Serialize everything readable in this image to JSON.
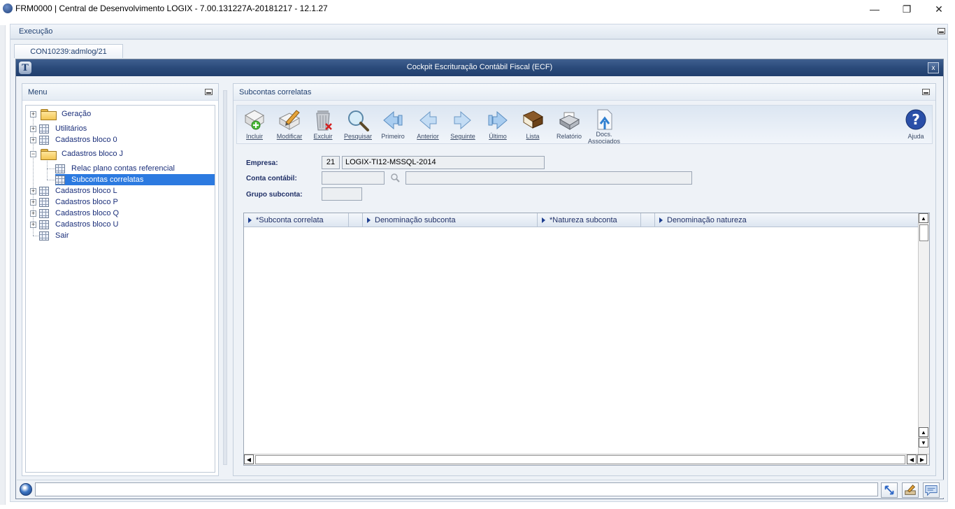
{
  "os_window": {
    "title": "FRM0000 | Central de Desenvolvimento LOGIX  -  7.00.131227A-20181217  -  12.1.27",
    "minimize_glyph": "—",
    "restore_glyph": "❐",
    "close_glyph": "✕"
  },
  "execution_bar": {
    "label": "Execução"
  },
  "tab": {
    "label": "CON10239:admlog/21"
  },
  "window": {
    "title": "Cockpit Escrituração Contábil Fiscal (ECF)",
    "logo": "T",
    "close_glyph": "x"
  },
  "menu": {
    "title": "Menu",
    "items": [
      {
        "label": "Geração",
        "type": "folder",
        "expander": "+"
      },
      {
        "label": "Utilitários",
        "type": "grid",
        "expander": "+"
      },
      {
        "label": "Cadastros bloco 0",
        "type": "grid",
        "expander": "+"
      },
      {
        "label": "Cadastros bloco J",
        "type": "folder",
        "expander": "−"
      },
      {
        "label": "Relac plano contas referencial",
        "type": "grid",
        "child": true
      },
      {
        "label": "Subcontas correlatas",
        "type": "grid",
        "child": true,
        "selected": true
      },
      {
        "label": "Cadastros bloco L",
        "type": "grid",
        "expander": "+"
      },
      {
        "label": "Cadastros bloco P",
        "type": "grid",
        "expander": "+"
      },
      {
        "label": "Cadastros bloco Q",
        "type": "grid",
        "expander": "+"
      },
      {
        "label": "Cadastros bloco U",
        "type": "grid",
        "expander": "+"
      },
      {
        "label": "Sair",
        "type": "grid"
      }
    ]
  },
  "main": {
    "title": "Subcontas correlatas",
    "toolbar": {
      "incluir": "Incluir",
      "modificar": "Modificar",
      "excluir": "Excluir",
      "pesquisar": "Pesquisar",
      "primeiro": "Primeiro",
      "anterior": "Anterior",
      "seguinte": "Seguinte",
      "ultimo": "Último",
      "lista": "Lista",
      "relatorio": "Relatório",
      "docs_line1": "Docs.",
      "docs_line2": "Associados",
      "ajuda": "Ajuda"
    },
    "form": {
      "empresa_label": "Empresa:",
      "empresa_code": "21",
      "empresa_name": "LOGIX-TI12-MSSQL-2014",
      "conta_label": "Conta contábil:",
      "conta_value": "",
      "conta_desc": "",
      "grupo_label": "Grupo subconta:",
      "grupo_value": ""
    },
    "grid": {
      "columns": [
        "*Subconta correlata",
        "Denominação subconta",
        "*Natureza subconta",
        "Denominação natureza"
      ],
      "rows": []
    }
  },
  "colors": {
    "title_bar": "#2a4a7a",
    "selection": "#2c7ae0",
    "panel_bg": "#eef2f7",
    "label_text": "#1f2f66"
  }
}
